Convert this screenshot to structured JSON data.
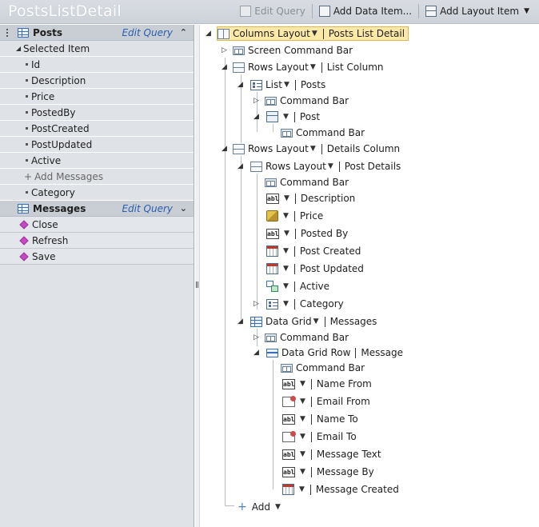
{
  "header": {
    "title": "PostsListDetail",
    "edit_query": "Edit Query",
    "add_data_item": "Add Data Item...",
    "add_layout_item": "Add Layout Item"
  },
  "left": {
    "posts_group": "Posts",
    "edit_query": "Edit Query",
    "selected_item": "Selected Item",
    "fields": [
      "Id",
      "Description",
      "Price",
      "PostedBy",
      "PostCreated",
      "PostUpdated",
      "Active"
    ],
    "add_messages": "Add Messages",
    "category": "Category",
    "messages_group": "Messages",
    "commands": [
      "Close",
      "Refresh",
      "Save"
    ]
  },
  "tree": {
    "root_type": "Columns Layout",
    "root_name": "Posts List Detail",
    "screen_command_bar": "Screen Command Bar",
    "rows_layout": "Rows Layout",
    "list_column": "List Column",
    "list": "List",
    "posts": "Posts",
    "command_bar": "Command Bar",
    "post": "Post",
    "details_column": "Details Column",
    "post_details": "Post Details",
    "description": "Description",
    "price": "Price",
    "posted_by": "Posted By",
    "post_created": "Post Created",
    "post_updated": "Post Updated",
    "active": "Active",
    "category": "Category",
    "data_grid": "Data Grid",
    "messages": "Messages",
    "data_grid_row": "Data Grid Row",
    "message": "Message",
    "name_from": "Name From",
    "email_from": "Email From",
    "name_to": "Name To",
    "email_to": "Email To",
    "message_text": "Message Text",
    "message_by": "Message By",
    "message_created": "Message Created",
    "add": "Add",
    "text_icon_label": "abl"
  }
}
